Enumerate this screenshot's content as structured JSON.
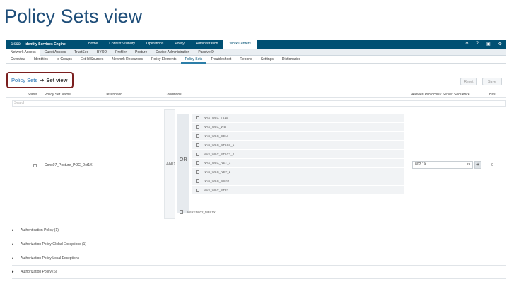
{
  "slide": {
    "title": "Policy Sets view"
  },
  "topnav": {
    "logo": "cisco",
    "brand": "Identity Services Engine",
    "items": [
      "Home",
      "Context Visibility",
      "Operations",
      "Policy",
      "Administration",
      "Work Centers"
    ],
    "icons": [
      "search-icon",
      "help-icon",
      "terminal-icon",
      "gear-icon"
    ]
  },
  "subnav": {
    "items": [
      "Network Access",
      "Guest Access",
      "TrustSec",
      "BYOD",
      "Profiler",
      "Posture",
      "Device Administration",
      "PassiveID"
    ]
  },
  "tabs": {
    "items": [
      "Overview",
      "Identities",
      "Id Groups",
      "Ext Id Sources",
      "Network Resources",
      "Policy Elements",
      "Policy Sets",
      "Troubleshoot",
      "Reports",
      "Settings",
      "Dictionaries"
    ]
  },
  "breadcrumb": {
    "link": "Policy Sets",
    "arrow": "➔",
    "current": "Set view"
  },
  "buttons": {
    "reset": "Reset",
    "save": "Save"
  },
  "table": {
    "headers": {
      "status": "Status",
      "name": "Policy Set Name",
      "description": "Description",
      "conditions": "Conditions",
      "protocols": "Allowed Protocols / Server Sequence",
      "hits": "Hits"
    },
    "search_placeholder": "Search"
  },
  "policy_row": {
    "name": "Cons07_Posture_POC_Dot1X",
    "and_label": "AND",
    "or_label": "OR",
    "conditions": [
      "NAS_WLC_7510",
      "NAS_WLC_WB",
      "NAS_WLC_CEN",
      "NAS_WLC_STLC1_1",
      "NAS_WLC_STLC1_2",
      "NAS_WLC_NET_1",
      "NAS_WLC_NET_2",
      "NAS_WLC_SCRJ",
      "NAS_WLC_STF1"
    ],
    "extra_condition": "WIRED802_MBL1X",
    "protocol": "802.1X",
    "hits": "0"
  },
  "sections": [
    "Authentication Policy (1)",
    "Authorization Policy Global Exceptions (1)",
    "Authorization Policy Local Exceptions",
    "Authorization Policy (6)"
  ]
}
